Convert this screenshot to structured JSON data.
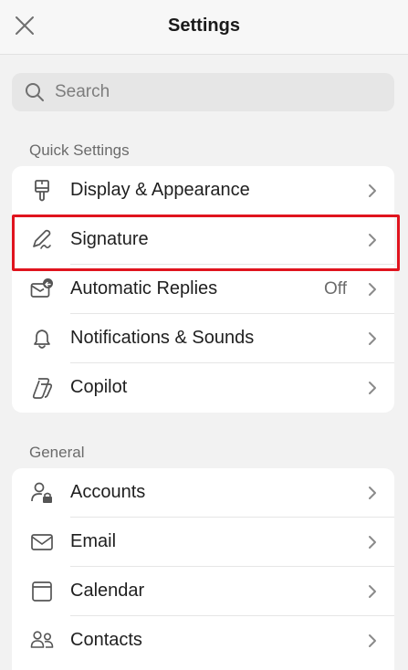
{
  "header": {
    "title": "Settings",
    "close_icon": "close-icon"
  },
  "search": {
    "placeholder": "Search",
    "value": ""
  },
  "quick_settings": {
    "title": "Quick Settings",
    "items": [
      {
        "label": "Display & Appearance",
        "icon": "paintbrush-icon"
      },
      {
        "label": "Signature",
        "icon": "signature-pen-icon"
      },
      {
        "label": "Automatic Replies",
        "value": "Off",
        "icon": "auto-reply-icon"
      },
      {
        "label": "Notifications & Sounds",
        "icon": "bell-icon"
      },
      {
        "label": "Copilot",
        "icon": "copilot-icon"
      }
    ]
  },
  "general": {
    "title": "General",
    "items": [
      {
        "label": "Accounts",
        "icon": "account-lock-icon"
      },
      {
        "label": "Email",
        "icon": "envelope-icon"
      },
      {
        "label": "Calendar",
        "icon": "calendar-icon"
      },
      {
        "label": "Contacts",
        "icon": "contacts-icon"
      }
    ]
  },
  "colors": {
    "highlight": "#e0141e",
    "background": "#f2f2f2",
    "card": "#ffffff"
  }
}
